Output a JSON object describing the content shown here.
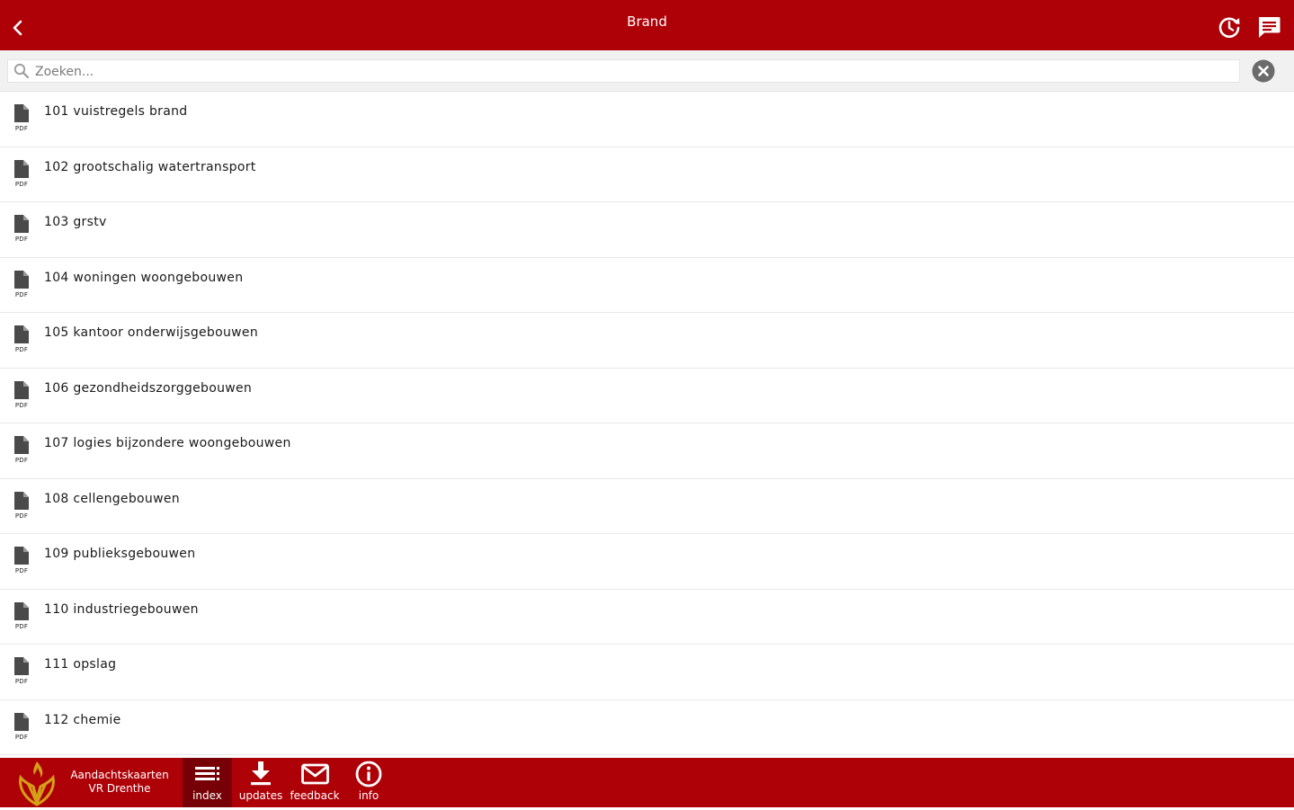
{
  "header": {
    "title": "Brand"
  },
  "search": {
    "placeholder": "Zoeken...",
    "value": ""
  },
  "list": {
    "file_type": "PDF",
    "items": [
      "101 vuistregels brand",
      "102 grootschalig watertransport",
      "103 grstv",
      "104 woningen woongebouwen",
      "105 kantoor onderwijsgebouwen",
      "106 gezondheidszorggebouwen",
      "107 logies bijzondere woongebouwen",
      "108 cellengebouwen",
      "109 publieksgebouwen",
      "110 industriegebouwen",
      "111 opslag",
      "112 chemie"
    ]
  },
  "footer": {
    "app_name_line1": "Aandachtskaarten",
    "app_name_line2": "VR Drenthe",
    "nav": [
      {
        "label": "index",
        "icon": "list-icon",
        "active": true
      },
      {
        "label": "updates",
        "icon": "download-icon",
        "active": false
      },
      {
        "label": "feedback",
        "icon": "mail-icon",
        "active": false
      },
      {
        "label": "info",
        "icon": "info-icon",
        "active": false
      }
    ]
  },
  "colors": {
    "brand_red": "#ae0007",
    "active_tab": "#760005",
    "logo_gold": "#d4a017"
  }
}
